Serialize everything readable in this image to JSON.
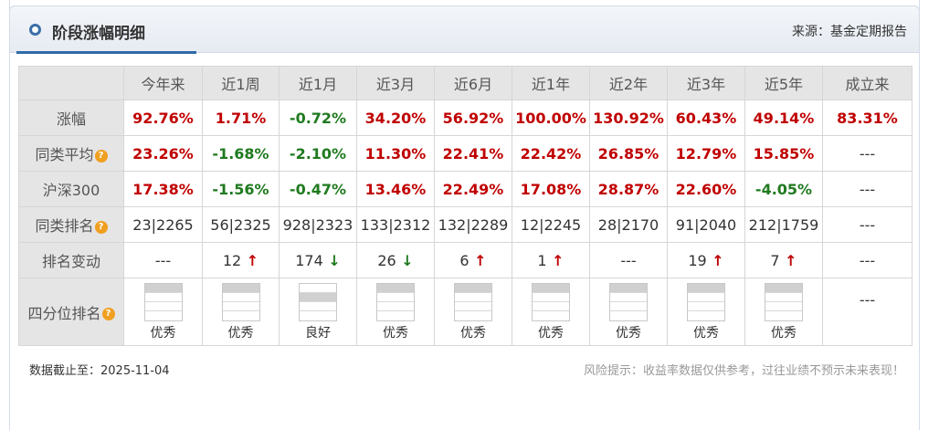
{
  "header": {
    "title": "阶段涨幅明细",
    "source": "来源：基金定期报告"
  },
  "columns": [
    "今年来",
    "近1周",
    "近1月",
    "近3月",
    "近6月",
    "近1年",
    "近2年",
    "近3年",
    "近5年",
    "成立来"
  ],
  "rows": {
    "return": {
      "label": "涨幅",
      "values": [
        "92.76%",
        "1.71%",
        "-0.72%",
        "34.20%",
        "56.92%",
        "100.00%",
        "130.92%",
        "60.43%",
        "49.14%",
        "83.31%"
      ],
      "signs": [
        "pos",
        "pos",
        "neg",
        "pos",
        "pos",
        "pos",
        "pos",
        "pos",
        "pos",
        "pos"
      ]
    },
    "peer_avg": {
      "label": "同类平均",
      "values": [
        "23.26%",
        "-1.68%",
        "-2.10%",
        "11.30%",
        "22.41%",
        "22.42%",
        "26.85%",
        "12.79%",
        "15.85%",
        "---"
      ],
      "signs": [
        "pos",
        "neg",
        "neg",
        "pos",
        "pos",
        "pos",
        "pos",
        "pos",
        "pos",
        "plain"
      ]
    },
    "hs300": {
      "label": "沪深300",
      "values": [
        "17.38%",
        "-1.56%",
        "-0.47%",
        "13.46%",
        "22.49%",
        "17.08%",
        "28.87%",
        "22.60%",
        "-4.05%",
        "---"
      ],
      "signs": [
        "pos",
        "neg",
        "neg",
        "pos",
        "pos",
        "pos",
        "pos",
        "pos",
        "neg",
        "plain"
      ]
    },
    "peer_rank": {
      "label": "同类排名",
      "values": [
        "23|2265",
        "56|2325",
        "928|2323",
        "133|2312",
        "132|2289",
        "12|2245",
        "28|2170",
        "91|2040",
        "212|1759",
        "---"
      ]
    },
    "rank_change": {
      "label": "排名变动",
      "values": [
        "---",
        "12",
        "174",
        "26",
        "6",
        "1",
        "---",
        "19",
        "7",
        "---"
      ],
      "arrows": [
        "",
        "↑",
        "↓",
        "↓",
        "↑",
        "↑",
        "",
        "↑",
        "↑",
        ""
      ]
    },
    "quartile": {
      "label": "四分位排名",
      "levels": [
        1,
        1,
        2,
        1,
        1,
        1,
        1,
        1,
        1,
        0
      ],
      "labels": [
        "优秀",
        "优秀",
        "良好",
        "优秀",
        "优秀",
        "优秀",
        "优秀",
        "优秀",
        "优秀",
        "---"
      ]
    }
  },
  "footer": {
    "date": "数据截止至：2025-11-04",
    "risk": "风险提示：收益率数据仅供参考，过往业绩不预示未来表现！"
  }
}
